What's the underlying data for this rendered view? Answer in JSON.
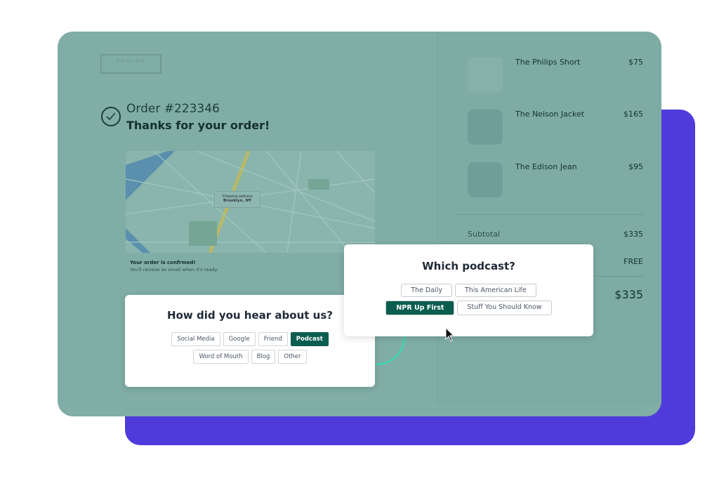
{
  "brand": {
    "logo_text": "EMBLEM"
  },
  "order": {
    "number": "Order #223346",
    "thanks": "Thanks for your order!"
  },
  "map": {
    "pin_label": "Shipping address",
    "pin_city": "Brooklyn, NY",
    "confirm_title": "Your order is confrmed!",
    "confirm_sub": "You'll recieve an email when it's ready."
  },
  "cart": {
    "items": [
      {
        "name": "The Philips Short",
        "price": "$75"
      },
      {
        "name": "The Nelson Jacket",
        "price": "$165"
      },
      {
        "name": "The Edison Jean",
        "price": "$95"
      }
    ],
    "subtotal_label": "Subtotal",
    "subtotal": "$335",
    "shipping": "FREE",
    "total": "$335"
  },
  "survey": {
    "title": "How did you hear about us?",
    "options": [
      "Social Media",
      "Google",
      "Friend",
      "Podcast",
      "Word of Mouth",
      "Blog",
      "Other"
    ],
    "selected": "Podcast"
  },
  "podcast": {
    "title": "Which podcast?",
    "options": [
      "The Daily",
      "This American Life",
      "NPR Up First",
      "Stuff You Should Know"
    ],
    "selected": "NPR Up First"
  },
  "colors": {
    "accent": "#0b5e4f",
    "purple": "#4f3bdb",
    "overlay": "#80ada6",
    "ring": "#2ee0b0"
  }
}
